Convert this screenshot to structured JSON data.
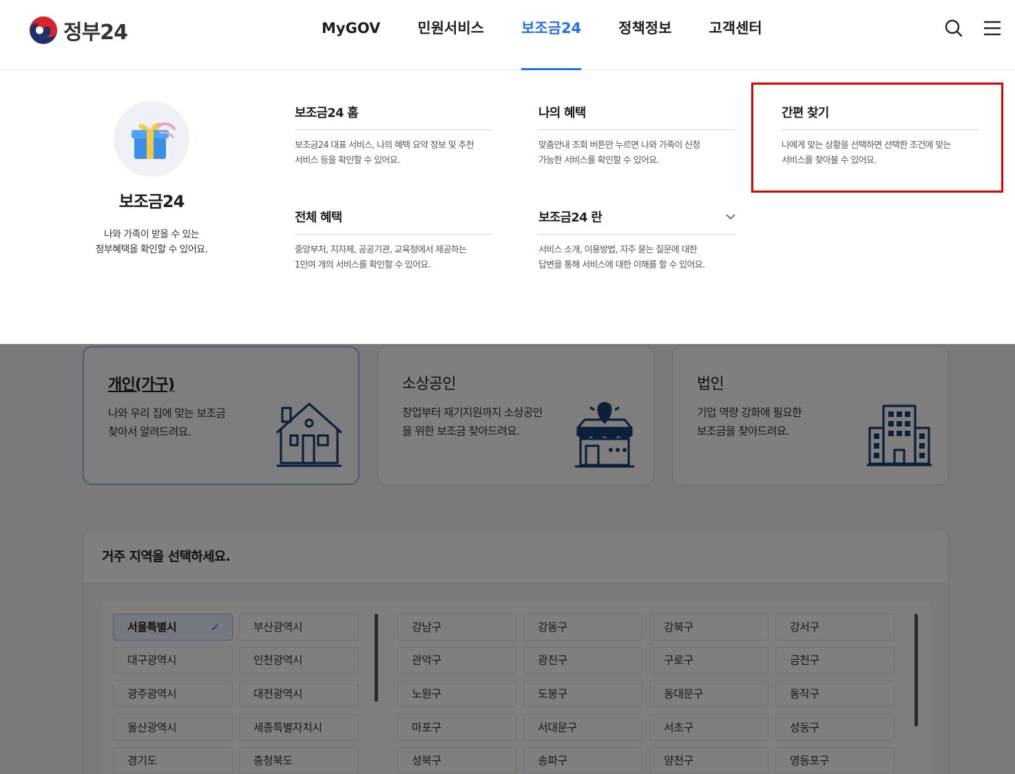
{
  "header": {
    "logo_text": "정부24",
    "nav": [
      {
        "label": "MyGOV",
        "active": false
      },
      {
        "label": "민원서비스",
        "active": false
      },
      {
        "label": "보조금24",
        "active": true
      },
      {
        "label": "정책정보",
        "active": false
      },
      {
        "label": "고객센터",
        "active": false
      }
    ],
    "search_icon": "search-icon",
    "menu_icon": "hamburger-menu-icon"
  },
  "mega_menu": {
    "promo": {
      "icon": "gift-box-icon",
      "title": "보조금24",
      "desc_line1": "나와 가족이 받을 수 있는",
      "desc_line2": "정부혜택을 확인할 수 있어요."
    },
    "items": [
      {
        "title": "보조금24 홈",
        "desc_line1": "보조금24 대표 서비스, 나의 혜택 요약 정보 및 추천",
        "desc_line2": "서비스 등을 확인할 수 있어요."
      },
      {
        "title": "나의 혜택",
        "desc_line1": "맞춤안내 조회 버튼만 누르면 나와 가족이 신청",
        "desc_line2": "가능한 서비스를 확인할 수 있어요."
      },
      {
        "title": "간편 찾기",
        "desc_line1": "나에게 맞는 상황을 선택하면 선택한 조건에 맞는",
        "desc_line2": "서비스를 찾아볼 수 있어요.",
        "highlighted": true
      },
      {
        "title": "전체 혜택",
        "desc_line1": "중앙부처, 지자체, 공공기관, 교육청에서 제공하는",
        "desc_line2": "1만여 개의 서비스를 확인할 수 있어요."
      },
      {
        "title": "보조금24 란",
        "desc_line1": "서비스 소개, 이용방법, 자주 묻는 질문에 대한",
        "desc_line2": "답변을 통해 서비스에 대한 이해를 할 수 있어요.",
        "has_dropdown": true
      }
    ]
  },
  "categories": [
    {
      "title": "개인(가구)",
      "desc_line1": "나와 우리 집에 맞는 보조금",
      "desc_line2": "찾아서 알려드려요.",
      "icon": "house-icon",
      "selected": true
    },
    {
      "title": "소상공인",
      "desc_line1": "창업부터 재기지원까지 소상공인",
      "desc_line2": "을 위한 보조금 찾아드려요.",
      "icon": "store-icon",
      "selected": false
    },
    {
      "title": "법인",
      "desc_line1": "기업 역량 강화에 필요한",
      "desc_line2": "보조금을 찾아드려요.",
      "icon": "building-icon",
      "selected": false
    }
  ],
  "region": {
    "heading": "거주 지역을 선택하세요.",
    "cities": [
      {
        "label": "서울특별시",
        "selected": true
      },
      {
        "label": "부산광역시"
      },
      {
        "label": "대구광역시"
      },
      {
        "label": "인천광역시"
      },
      {
        "label": "광주광역시"
      },
      {
        "label": "대전광역시"
      },
      {
        "label": "울산광역시"
      },
      {
        "label": "세종특별자치시"
      },
      {
        "label": "경기도"
      },
      {
        "label": "충청북도"
      }
    ],
    "districts": [
      "강남구",
      "강동구",
      "강북구",
      "강서구",
      "관악구",
      "광진구",
      "구로구",
      "금천구",
      "노원구",
      "도봉구",
      "동대문구",
      "동작구",
      "마포구",
      "서대문구",
      "서초구",
      "성동구",
      "성북구",
      "송파구",
      "양천구",
      "영등포구"
    ]
  },
  "colors": {
    "accent": "#256ef4",
    "highlight_border": "#e10000",
    "illustration": "#1d3f73"
  }
}
